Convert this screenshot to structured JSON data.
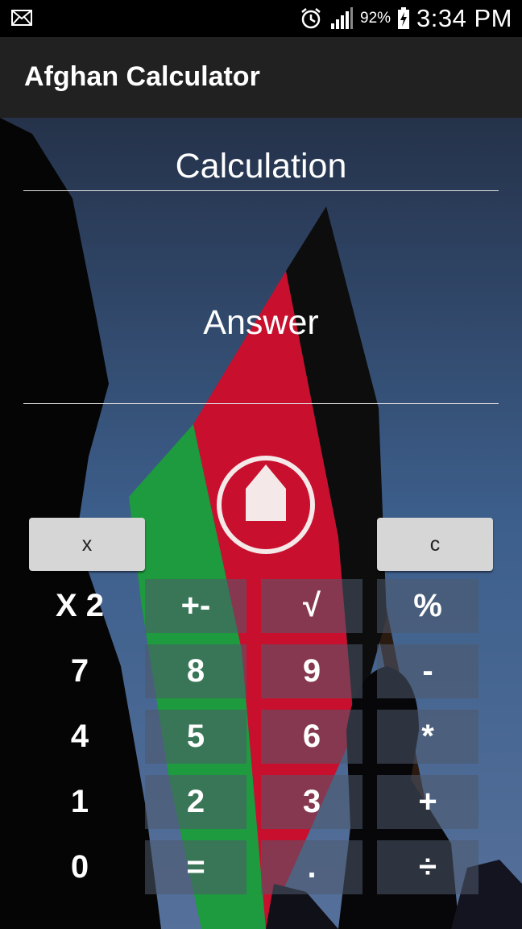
{
  "status_bar": {
    "battery": "92%",
    "time": "3:34 PM",
    "icons": [
      "mail-icon",
      "alarm-icon",
      "signal-icon",
      "battery-charging-icon"
    ]
  },
  "app_bar": {
    "title": "Afghan Calculator"
  },
  "display": {
    "calculation_placeholder": "Calculation",
    "answer_placeholder": "Answer"
  },
  "top_buttons": {
    "backspace": "x",
    "clear": "c"
  },
  "keys": {
    "r1": [
      "X 2",
      "+-",
      "√",
      "%"
    ],
    "r2": [
      "7",
      "8",
      "9",
      "-"
    ],
    "r3": [
      "4",
      "5",
      "6",
      "*"
    ],
    "r4": [
      "1",
      "2",
      "3",
      "+"
    ],
    "r5": [
      "0",
      "=",
      ".",
      "÷"
    ]
  },
  "colors": {
    "flag_black": "#0a0a0a",
    "flag_red": "#c8102e",
    "flag_green": "#1e9a3f",
    "sky": "#3a5f8c"
  }
}
